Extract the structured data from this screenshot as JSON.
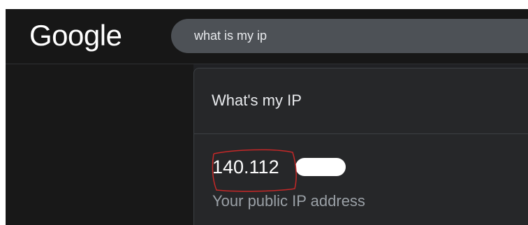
{
  "header": {
    "logo_text": "Google",
    "search_query": "what is my ip"
  },
  "result_card": {
    "title": "What's my IP",
    "ip_address": "140.112",
    "ip_caption": "Your public IP address"
  },
  "colors": {
    "background": "#202124",
    "header": "#171717",
    "search_box": "#4d5156",
    "annotation_red": "#c62828"
  }
}
